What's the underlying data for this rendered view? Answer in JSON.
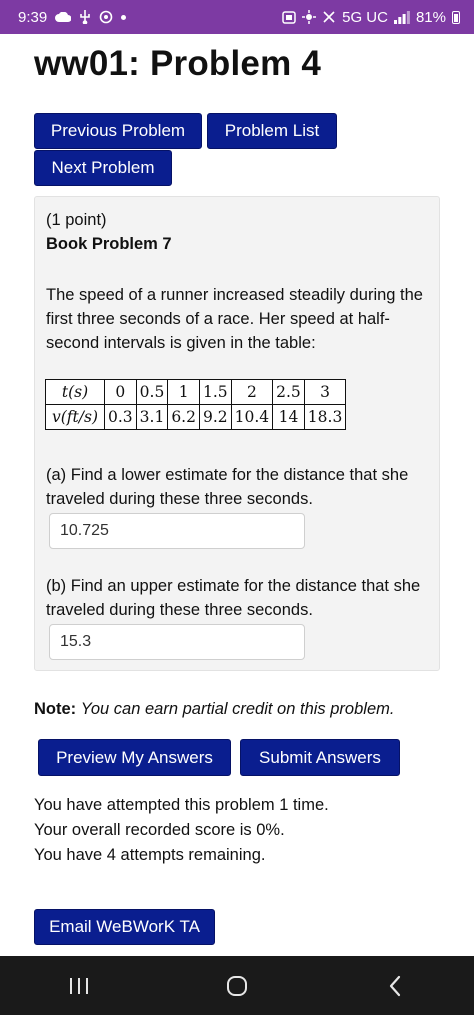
{
  "statusbar": {
    "time": "9:39",
    "network": "5G UC",
    "battery": "81%"
  },
  "page": {
    "title": "ww01: Problem 4"
  },
  "nav_buttons": {
    "previous": "Previous Problem",
    "list": "Problem List",
    "next": "Next Problem"
  },
  "problem": {
    "points": "(1 point)",
    "book_problem": "Book Problem 7",
    "statement": "The speed of a runner increased steadily during the first three seconds of a race. Her speed at half-second intervals is given in the table:",
    "table": {
      "row_t_label": "t(s)",
      "row_v_label": "v(ft/s)",
      "t_values": [
        "0",
        "0.5",
        "1",
        "1.5",
        "2",
        "2.5",
        "3"
      ],
      "v_values": [
        "0.3",
        "3.1",
        "6.2",
        "9.2",
        "10.4",
        "14",
        "18.3"
      ]
    },
    "part_a": {
      "prompt": "(a) Find a lower estimate for the distance that she traveled during these three seconds.",
      "answer": "10.725"
    },
    "part_b": {
      "prompt": "(b) Find an upper estimate for the distance that she traveled during these three seconds.",
      "answer": "15.3"
    }
  },
  "note": {
    "label": "Note:",
    "text": "You can earn partial credit on this problem."
  },
  "actions": {
    "preview": "Preview My Answers",
    "submit": "Submit Answers",
    "email": "Email WeBWorK TA"
  },
  "attempts": {
    "line1": "You have attempted this problem 1 time.",
    "line2": "Your overall recorded score is 0%.",
    "line3": "You have 4 attempts remaining."
  },
  "icons": {
    "cloud": "cloud-icon",
    "usb": "usb-icon",
    "sync": "sync-icon",
    "alarm": "alarm-icon",
    "mute": "mute-icon",
    "signal": "signal-icon",
    "battery": "battery-icon",
    "recents": "recents-icon",
    "home": "home-icon",
    "back": "back-icon"
  },
  "colors": {
    "statusbar": "#7d3aa3",
    "button": "#0a1e8f",
    "panel": "#f3f3f3",
    "navbar": "#1a1a1a"
  }
}
